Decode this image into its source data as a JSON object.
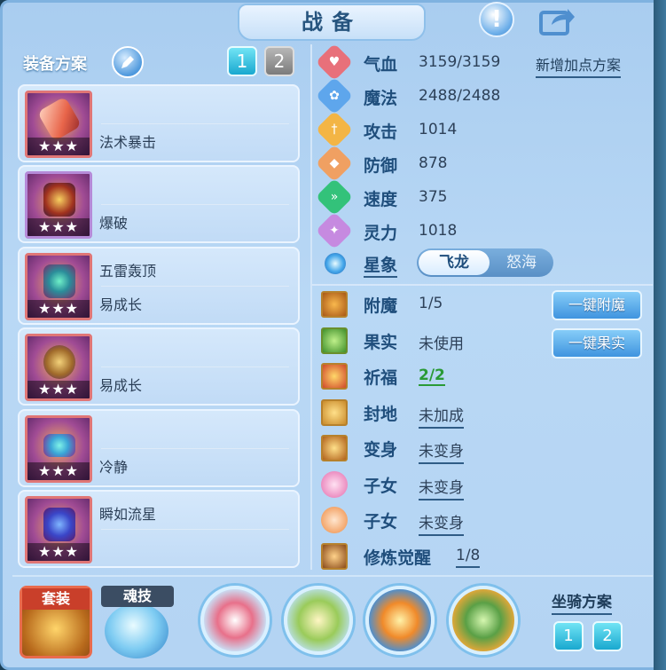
{
  "window": {
    "title": "战备"
  },
  "colors": {
    "accent": "#1f4e7c",
    "panel": "#b4d4f3",
    "green": "#2a9a36"
  },
  "equipment": {
    "heading": "装备方案",
    "schemes": [
      "1",
      "2"
    ],
    "items": [
      {
        "lines": [
          "",
          "法术暴击"
        ],
        "stars": "★★★"
      },
      {
        "lines": [
          "",
          "爆破"
        ],
        "stars": "★★★"
      },
      {
        "lines": [
          "五雷轰顶",
          "易成长"
        ],
        "stars": "★★★"
      },
      {
        "lines": [
          "",
          "易成长"
        ],
        "stars": "★★★"
      },
      {
        "lines": [
          "",
          "冷静"
        ],
        "stars": "★★★"
      },
      {
        "lines": [
          "瞬如流星",
          ""
        ],
        "stars": "★★★"
      }
    ]
  },
  "stats": {
    "new_plan": "新增加点方案",
    "rows": [
      {
        "label": "气血",
        "value": "3159/3159",
        "icon": "heart-icon",
        "color": "#e8707a"
      },
      {
        "label": "魔法",
        "value": "2488/2488",
        "icon": "mana-icon",
        "color": "#5ea6ec"
      },
      {
        "label": "攻击",
        "value": "1014",
        "icon": "sword-icon",
        "color": "#f3b545"
      },
      {
        "label": "防御",
        "value": "878",
        "icon": "shield-icon",
        "color": "#f0a062"
      },
      {
        "label": "速度",
        "value": "375",
        "icon": "speed-icon",
        "color": "#33c27a"
      },
      {
        "label": "灵力",
        "value": "1018",
        "icon": "spirit-icon",
        "color": "#c68ae0"
      }
    ]
  },
  "star_sign": {
    "label": "星象",
    "options": [
      "飞龙",
      "怒海"
    ],
    "selected": "飞龙"
  },
  "misc": {
    "rows": [
      {
        "label": "附魔",
        "value": "1/5",
        "style": ""
      },
      {
        "label": "果实",
        "value": "未使用",
        "style": ""
      },
      {
        "label": "祈福",
        "value": "2/2",
        "style": "green"
      },
      {
        "label": "封地",
        "value": "未加成",
        "style": "ul"
      },
      {
        "label": "变身",
        "value": "未变身",
        "style": "ul"
      },
      {
        "label": "子女",
        "value": "未变身",
        "style": "ul"
      },
      {
        "label": "子女",
        "value": "未变身",
        "style": "ul"
      },
      {
        "label": "修炼觉醒",
        "value": "1/8",
        "style": "ul"
      }
    ],
    "buttons": [
      "一键附魔",
      "一键果实"
    ]
  },
  "bottom": {
    "suit_label": "套装",
    "soul_label": "魂技",
    "mount_title": "坐骑方案",
    "mount_schemes": [
      "1",
      "2"
    ]
  }
}
